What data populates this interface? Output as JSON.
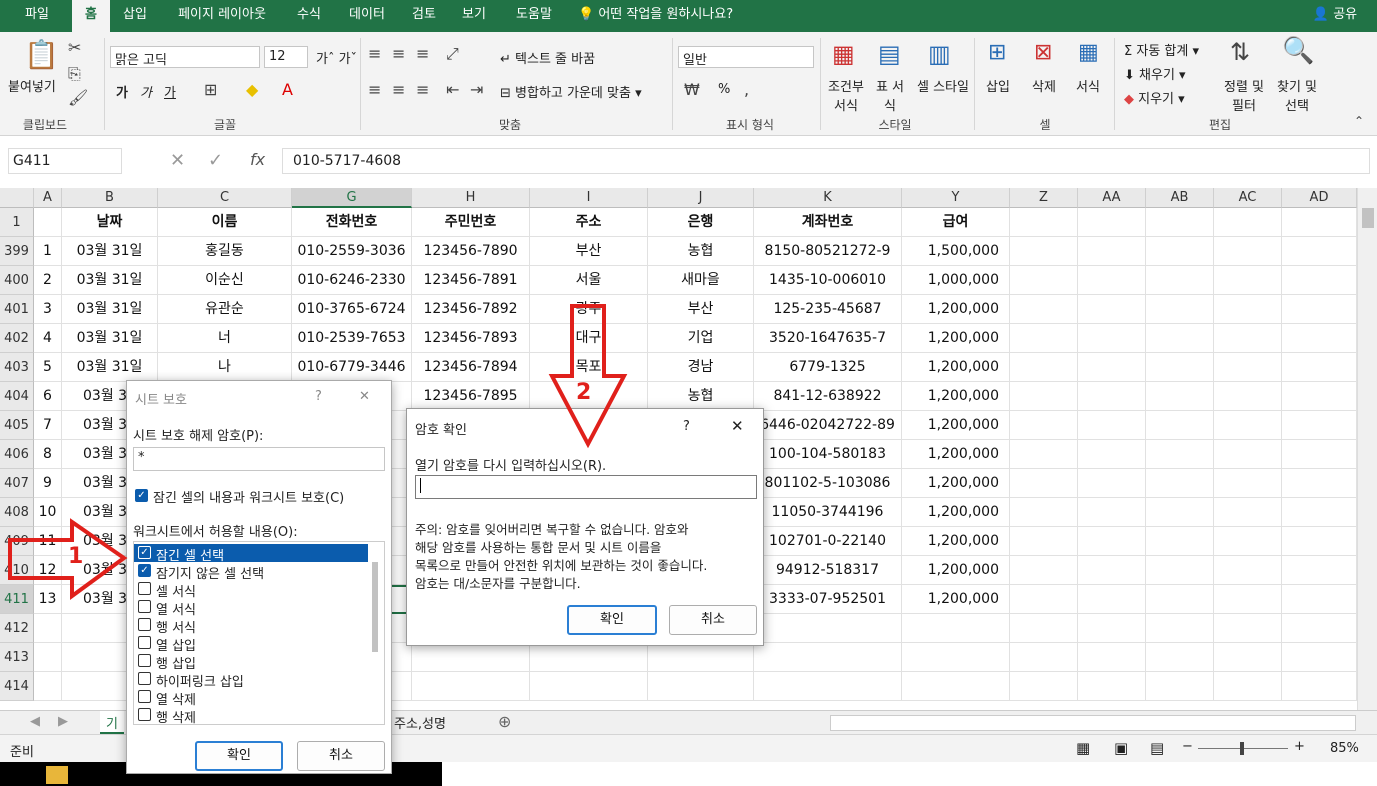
{
  "tabs": [
    "파일",
    "홈",
    "삽입",
    "페이지 레이아웃",
    "수식",
    "데이터",
    "검토",
    "보기",
    "도움말"
  ],
  "search": "어떤 작업을 원하시나요?",
  "share": "공유",
  "ribbon": {
    "clipboard": {
      "paste": "붙여넣기",
      "group": "클립보드"
    },
    "font": {
      "name": "맑은 고딕",
      "size": "12",
      "group": "글꼴",
      "bold": "가",
      "italic": "가",
      "underline": "가"
    },
    "align": {
      "wrap": "텍스트 줄 바꿈",
      "merge": "병합하고 가운데 맞춤",
      "group": "맞춤"
    },
    "number": {
      "format": "일반",
      "pct": "%",
      "group": "표시 형식"
    },
    "styles": {
      "cond": "조건부 서식",
      "table": "표 서식",
      "cell": "셀 스타일",
      "group": "스타일"
    },
    "cells": {
      "insert": "삽입",
      "delete": "삭제",
      "format": "서식",
      "group": "셀"
    },
    "edit": {
      "autosum": "자동 합계",
      "fill": "채우기",
      "clear": "지우기",
      "sort": "정렬 및 필터",
      "find": "찾기 및 선택",
      "group": "편집"
    }
  },
  "formula": {
    "namebox": "G411",
    "fx": "fx",
    "value": "010-5717-4608"
  },
  "columns": [
    "A",
    "B",
    "C",
    "G",
    "H",
    "I",
    "J",
    "K",
    "Y",
    "Z",
    "AA",
    "AB",
    "AC",
    "AD"
  ],
  "header_row": {
    "num": "1",
    "cells": [
      "",
      "날짜",
      "이름",
      "전화번호",
      "주민번호",
      "주소",
      "은행",
      "계좌번호",
      "급여"
    ]
  },
  "rows": [
    {
      "num": "399",
      "cells": [
        "1",
        "03월 31일",
        "홍길동",
        "010-2559-3036",
        "123456-7890",
        "부산",
        "농협",
        "8150-80521272-9",
        "1,500,000"
      ]
    },
    {
      "num": "400",
      "cells": [
        "2",
        "03월 31일",
        "이순신",
        "010-6246-2330",
        "123456-7891",
        "서울",
        "새마을",
        "1435-10-006010",
        "1,000,000"
      ]
    },
    {
      "num": "401",
      "cells": [
        "3",
        "03월 31일",
        "유관순",
        "010-3765-6724",
        "123456-7892",
        "광주",
        "부산",
        "125-235-45687",
        "1,200,000"
      ]
    },
    {
      "num": "402",
      "cells": [
        "4",
        "03월 31일",
        "너",
        "010-2539-7653",
        "123456-7893",
        "대구",
        "기업",
        "3520-1647635-7",
        "1,200,000"
      ]
    },
    {
      "num": "403",
      "cells": [
        "5",
        "03월 31일",
        "나",
        "010-6779-3446",
        "123456-7894",
        "목포",
        "경남",
        "6779-1325",
        "1,200,000"
      ]
    },
    {
      "num": "404",
      "cells": [
        "6",
        "03월 31",
        "",
        "2",
        "123456-7895",
        "",
        "농협",
        "841-12-638922",
        "1,200,000"
      ]
    },
    {
      "num": "405",
      "cells": [
        "7",
        "03월 31",
        "",
        "5",
        "",
        "",
        "",
        "6446-02042722-89",
        "1,200,000"
      ]
    },
    {
      "num": "406",
      "cells": [
        "8",
        "03월 31",
        "",
        "",
        "",
        "",
        "",
        "100-104-580183",
        "1,200,000"
      ]
    },
    {
      "num": "407",
      "cells": [
        "9",
        "03월 31",
        "",
        "6",
        "",
        "",
        "",
        "801102-5-103086",
        "1,200,000"
      ]
    },
    {
      "num": "408",
      "cells": [
        "10",
        "03월 31",
        "",
        "",
        "",
        "",
        "",
        "11050-3744196",
        "1,200,000"
      ]
    },
    {
      "num": "409",
      "cells": [
        "11",
        "03월 31",
        "",
        "0",
        "",
        "",
        "",
        "102701-0-22140",
        "1,200,000"
      ]
    },
    {
      "num": "410",
      "cells": [
        "12",
        "03월 31",
        "",
        "1",
        "",
        "",
        "",
        "94912-518317",
        "1,200,000"
      ]
    },
    {
      "num": "411",
      "cells": [
        "13",
        "03월 31",
        "",
        "8",
        "",
        "",
        "",
        "3333-07-952501",
        "1,200,000"
      ]
    },
    {
      "num": "412",
      "cells": [
        "",
        "",
        "",
        "",
        "",
        "",
        "",
        "",
        ""
      ]
    },
    {
      "num": "413",
      "cells": [
        "",
        "",
        "",
        "",
        "",
        "",
        "",
        "",
        ""
      ]
    },
    {
      "num": "414",
      "cells": [
        "",
        "",
        "",
        "",
        "",
        "",
        "",
        "",
        ""
      ]
    }
  ],
  "sheet_tabs": [
    "기",
    "주소,성명"
  ],
  "status": {
    "ready": "준비",
    "zoom": "85%"
  },
  "protect_dialog": {
    "title": "시트 보호",
    "pw_label": "시트 보호 해제 암호(P):",
    "pw_value": "*",
    "protect_chk": "잠긴 셀의 내용과 워크시트 보호(C)",
    "allow_label": "워크시트에서 허용할 내용(O):",
    "items": [
      {
        "label": "잠긴 셀 선택",
        "checked": true
      },
      {
        "label": "잠기지 않은 셀 선택",
        "checked": true
      },
      {
        "label": "셀 서식",
        "checked": false
      },
      {
        "label": "열 서식",
        "checked": false
      },
      {
        "label": "행 서식",
        "checked": false
      },
      {
        "label": "열 삽입",
        "checked": false
      },
      {
        "label": "행 삽입",
        "checked": false
      },
      {
        "label": "하이퍼링크 삽입",
        "checked": false
      },
      {
        "label": "열 삭제",
        "checked": false
      },
      {
        "label": "행 삭제",
        "checked": false
      }
    ],
    "ok": "확인",
    "cancel": "취소",
    "help": "?",
    "close": "✕"
  },
  "confirm_dialog": {
    "title": "암호 확인",
    "prompt": "열기 암호를 다시 입력하십시오(R).",
    "note1": "주의: 암호를 잊어버리면 복구할 수 없습니다. 암호와",
    "note2": "해당 암호를 사용하는 통합 문서 및 시트 이름을",
    "note3": "목록으로 만들어 안전한 위치에 보관하는 것이 좋습니다.",
    "note4": "암호는 대/소문자를 구분합니다.",
    "ok": "확인",
    "cancel": "취소",
    "help": "?",
    "close": "✕"
  },
  "annotations": {
    "one": "1",
    "two": "2"
  },
  "colors": {
    "excel_green": "#217346",
    "annotation_red": "#e0201b",
    "selection_blue": "#0b5cad"
  }
}
